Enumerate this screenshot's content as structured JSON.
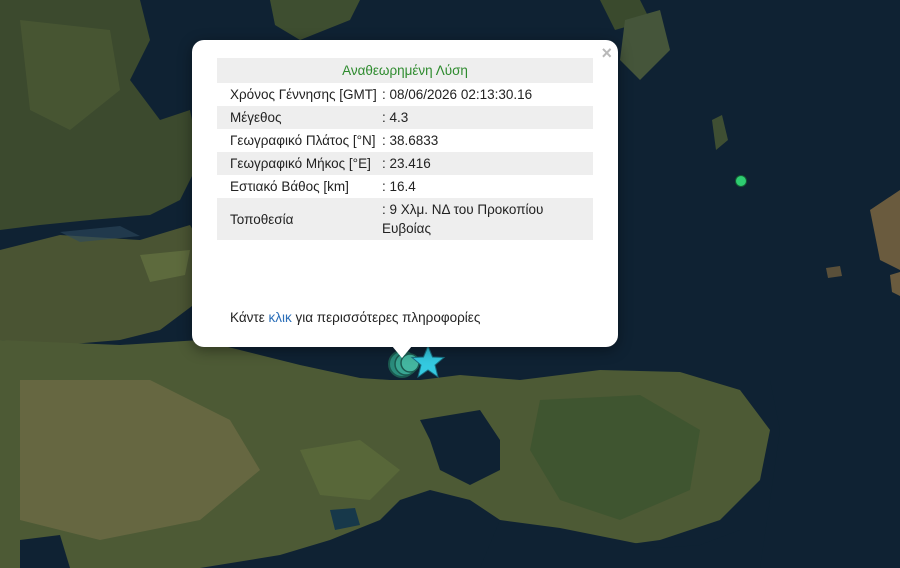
{
  "colors": {
    "sea": "#0f2233",
    "land_dark": "#2f4a2a",
    "land_light": "#6b6a4a",
    "header_green": "#2e8b2e",
    "link_blue": "#2a6eb8",
    "star": "#34c9e0",
    "event_dot": "#2ecc71"
  },
  "popup": {
    "close_label": "×",
    "header": "Αναθεωρημένη Λύση",
    "rows": [
      {
        "label": "Χρόνος Γέννησης [GMT]",
        "value": ": 08/06/2026 02:13:30.16"
      },
      {
        "label": "Μέγεθος",
        "value": ": 4.3"
      },
      {
        "label": "Γεωγραφικό Πλάτος [°N]",
        "value": ": 38.6833"
      },
      {
        "label": "Γεωγραφικό Μήκος [°E]",
        "value": ": 23.416"
      },
      {
        "label": "Εστιακό Βάθος [km]",
        "value": ": 16.4"
      },
      {
        "label": "Τοποθεσία",
        "value": ": 9 Χλμ. ΝΔ του Προκοπίου Ευβοίας"
      }
    ],
    "more_prefix": "Κάντε ",
    "more_link": "κλικ",
    "more_suffix": " για περισσότερες πληροφορίες"
  },
  "markers": {
    "epicenter_icon": "star-icon",
    "cluster_icon": "earthquake-cluster-icon",
    "event_icon": "event-dot-icon"
  }
}
